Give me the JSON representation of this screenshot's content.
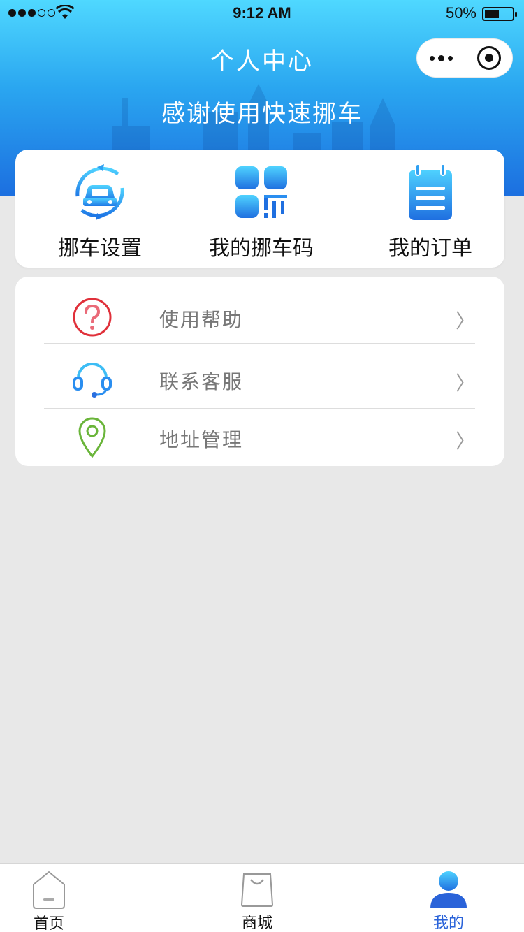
{
  "status_bar": {
    "time": "9:12 AM",
    "battery": "50%"
  },
  "header": {
    "title": "个人中心",
    "subtitle": "感谢使用快速挪车"
  },
  "quick_actions": [
    {
      "label": "挪车设置",
      "icon": "car-refresh-icon"
    },
    {
      "label": "我的挪车码",
      "icon": "qr-code-icon"
    },
    {
      "label": "我的订单",
      "icon": "notepad-icon"
    }
  ],
  "menu": [
    {
      "label": "使用帮助",
      "icon": "question-icon",
      "chevron": "〉"
    },
    {
      "label": "联系客服",
      "icon": "headset-icon",
      "chevron": "〉"
    },
    {
      "label": "地址管理",
      "icon": "location-pin-icon",
      "chevron": "〉"
    }
  ],
  "tabs": [
    {
      "label": "首页",
      "icon": "home-icon"
    },
    {
      "label": "商城",
      "icon": "shopping-bag-icon"
    },
    {
      "label": "我的",
      "icon": "user-icon",
      "active": true
    }
  ],
  "colors": {
    "header_top": "#4fd8ff",
    "header_bottom": "#1c6fe0",
    "active_tab": "#2a63d9",
    "help_red": "#e0303a",
    "service_blue": "#2a8ef0",
    "address_green": "#6ab53a"
  }
}
